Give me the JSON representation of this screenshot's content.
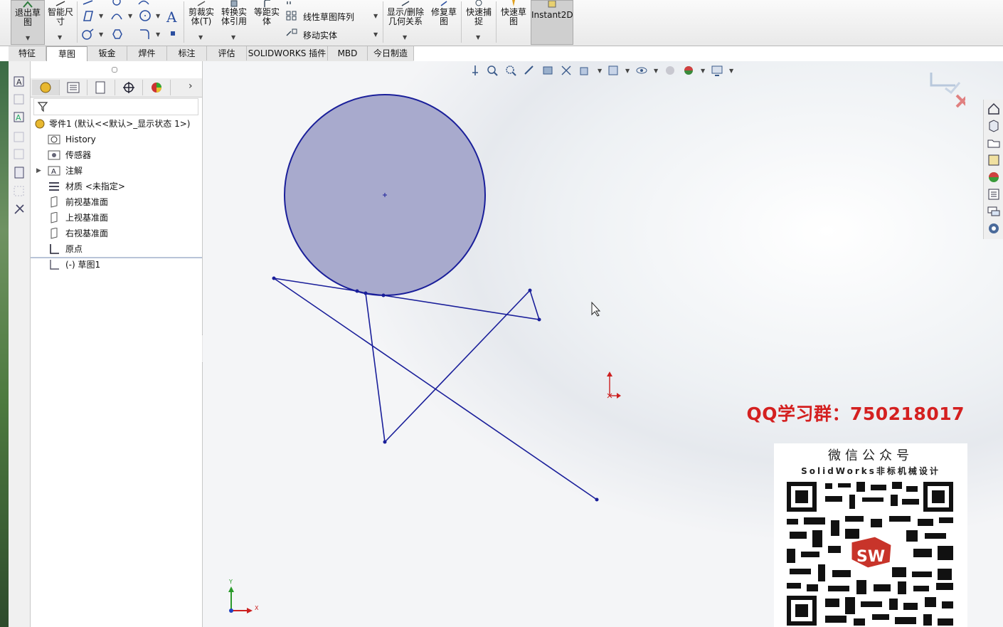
{
  "ribbon": {
    "exit_sketch": "退出草图",
    "smart_dimension": "智能尺寸",
    "trim_entities": "剪裁实体",
    "trim_suffix": "(T)",
    "convert_entities": "转换实体引用",
    "offset_entities": "等距实体",
    "linear_pattern": "线性草图阵列",
    "move_entities": "移动实体",
    "show_delete_relations": "显示/删除几何关系",
    "repair_sketch": "修复草图",
    "quick_snaps": "快速捕捉",
    "rapid_sketch": "快速草图",
    "instant2d": "Instant2D"
  },
  "tabs": [
    {
      "label": "特征"
    },
    {
      "label": "草图"
    },
    {
      "label": "钣金"
    },
    {
      "label": "焊件"
    },
    {
      "label": "标注"
    },
    {
      "label": "评估"
    },
    {
      "label": "SOLIDWORKS 插件"
    },
    {
      "label": "MBD"
    },
    {
      "label": "今日制造"
    }
  ],
  "active_tab": "草图",
  "tree": {
    "root": "零件1  (默认<<默认>_显示状态 1>)",
    "items": [
      {
        "label": "History"
      },
      {
        "label": "传感器"
      },
      {
        "label": "注解"
      },
      {
        "label": "材质 <未指定>"
      },
      {
        "label": "前视基准面"
      },
      {
        "label": "上视基准面"
      },
      {
        "label": "右视基准面"
      },
      {
        "label": "原点"
      },
      {
        "label": "(-) 草图1"
      }
    ]
  },
  "triad": {
    "x_label": "X",
    "y_label": "Y"
  },
  "overlay": {
    "qq": "QQ学习群：750218017",
    "wechat_title": "微信公众号",
    "wechat_sub": "SolidWorks非标机械设计",
    "logo_text": "SW"
  },
  "colors": {
    "sketch_line": "#1a1f9a",
    "circle_fill": "#a7a9cc",
    "qq_text": "#d42020"
  }
}
